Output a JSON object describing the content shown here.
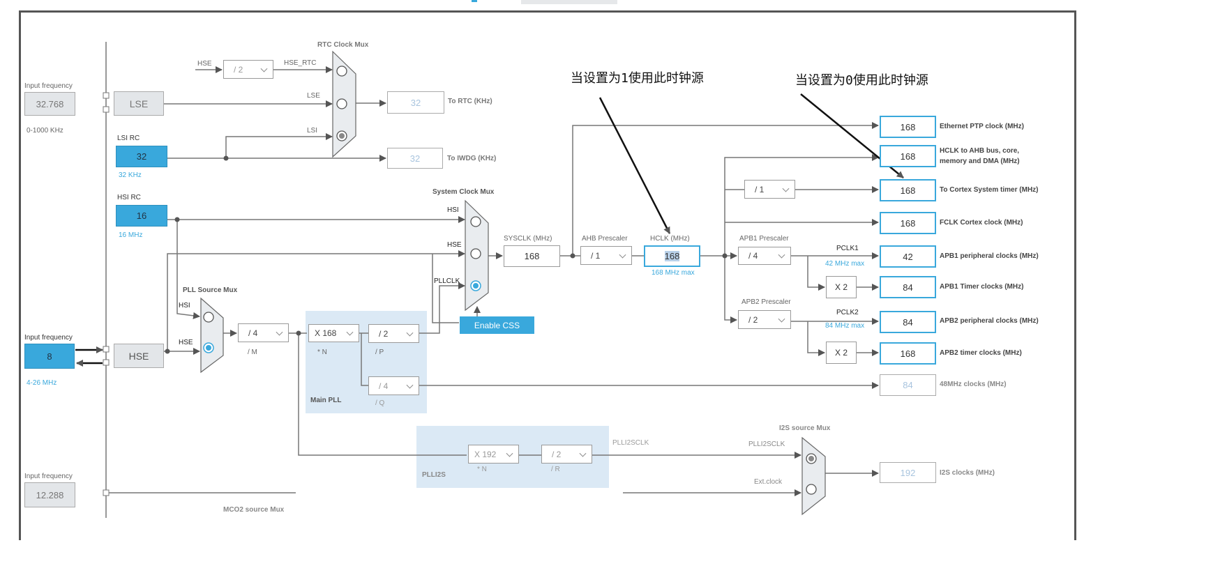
{
  "sources": {
    "lse_input": {
      "label": "Input frequency",
      "value": "32.768",
      "range": "0-1000 KHz"
    },
    "lse": "LSE",
    "lsi": {
      "label": "LSI RC",
      "value": "32",
      "unit": "32 KHz"
    },
    "hsi": {
      "label": "HSI RC",
      "value": "16",
      "unit": "16 MHz"
    },
    "hse_input": {
      "label": "Input frequency",
      "value": "8",
      "range": "4-26 MHz"
    },
    "hse": "HSE",
    "i2s_input": {
      "label": "Input frequency",
      "value": "12.288"
    }
  },
  "rtc": {
    "mux_title": "RTC Clock Mux",
    "hse_label": "HSE",
    "div": "/ 2",
    "hse_rtc": "HSE_RTC",
    "lse_label": "LSE",
    "lsi_label": "LSI",
    "rtc_value": "32",
    "rtc_label": "To RTC (KHz)",
    "iwdg_value": "32",
    "iwdg_label": "To IWDG (KHz)",
    "selected": "LSI"
  },
  "sysmux": {
    "title": "System Clock Mux",
    "hsi": "HSI",
    "hse": "HSE",
    "pllclk": "PLLCLK",
    "selected": "PLLCLK",
    "enable_css": "Enable CSS"
  },
  "sysclk": {
    "label": "SYSCLK (MHz)",
    "value": "168"
  },
  "ahb": {
    "label": "AHB Prescaler",
    "value": "/ 1"
  },
  "hclk": {
    "label": "HCLK (MHz)",
    "value": "168",
    "max": "168 MHz max"
  },
  "pllmux": {
    "title": "PLL Source Mux",
    "hsi": "HSI",
    "hse": "HSE",
    "selected": "HSE"
  },
  "pll": {
    "m": "/ 4",
    "m_label": "/ M",
    "n": "X 168",
    "n_label": "* N",
    "p": "/ 2",
    "p_label": "/ P",
    "q": "/ 4",
    "q_label": "/ Q",
    "title": "Main PLL"
  },
  "plli2s": {
    "n": "X 192",
    "n_label": "* N",
    "r": "/ 2",
    "r_label": "/ R",
    "title": "PLLI2S",
    "clk": "PLLI2SCLK"
  },
  "i2smux": {
    "title": "I2S source Mux",
    "plli2sclk": "PLLI2SCLK",
    "ext": "Ext.clock",
    "value": "192",
    "label": "I2S clocks (MHz)",
    "selected": "PLLI2SCLK"
  },
  "mco2": "MCO2 source Mux",
  "outputs": {
    "eth": {
      "value": "168",
      "label": "Ethernet PTP clock (MHz)"
    },
    "ahb": {
      "value": "168",
      "label1": "HCLK to AHB bus, core,",
      "label2": "memory and DMA (MHz)"
    },
    "cortex_div": "/ 1",
    "cortex": {
      "value": "168",
      "label": "To Cortex System timer (MHz)"
    },
    "fclk": {
      "value": "168",
      "label": "FCLK Cortex clock (MHz)"
    },
    "apb1_pres_label": "APB1 Prescaler",
    "apb1_pres": "/ 4",
    "pclk1": "PCLK1",
    "pclk1_max": "42 MHz max",
    "apb1p": {
      "value": "42",
      "label": "APB1 peripheral clocks (MHz)"
    },
    "apb1_mult": "X 2",
    "apb1t": {
      "value": "84",
      "label": "APB1 Timer clocks (MHz)"
    },
    "apb2_pres_label": "APB2 Prescaler",
    "apb2_pres": "/ 2",
    "pclk2": "PCLK2",
    "pclk2_max": "84 MHz max",
    "apb2p": {
      "value": "84",
      "label": "APB2 peripheral clocks (MHz)"
    },
    "apb2_mult": "X 2",
    "apb2t": {
      "value": "168",
      "label": "APB2 timer clocks (MHz)"
    },
    "mhz48": {
      "value": "84",
      "label": "48MHz clocks (MHz)"
    }
  },
  "annotations": {
    "note1": "当设置为1使用此时钟源",
    "note2": "当设置为0使用此时钟源"
  },
  "colors": {
    "accent": "#39a8dc",
    "panel": "#dbe9f5",
    "source_gray": "#e3e6e9"
  }
}
